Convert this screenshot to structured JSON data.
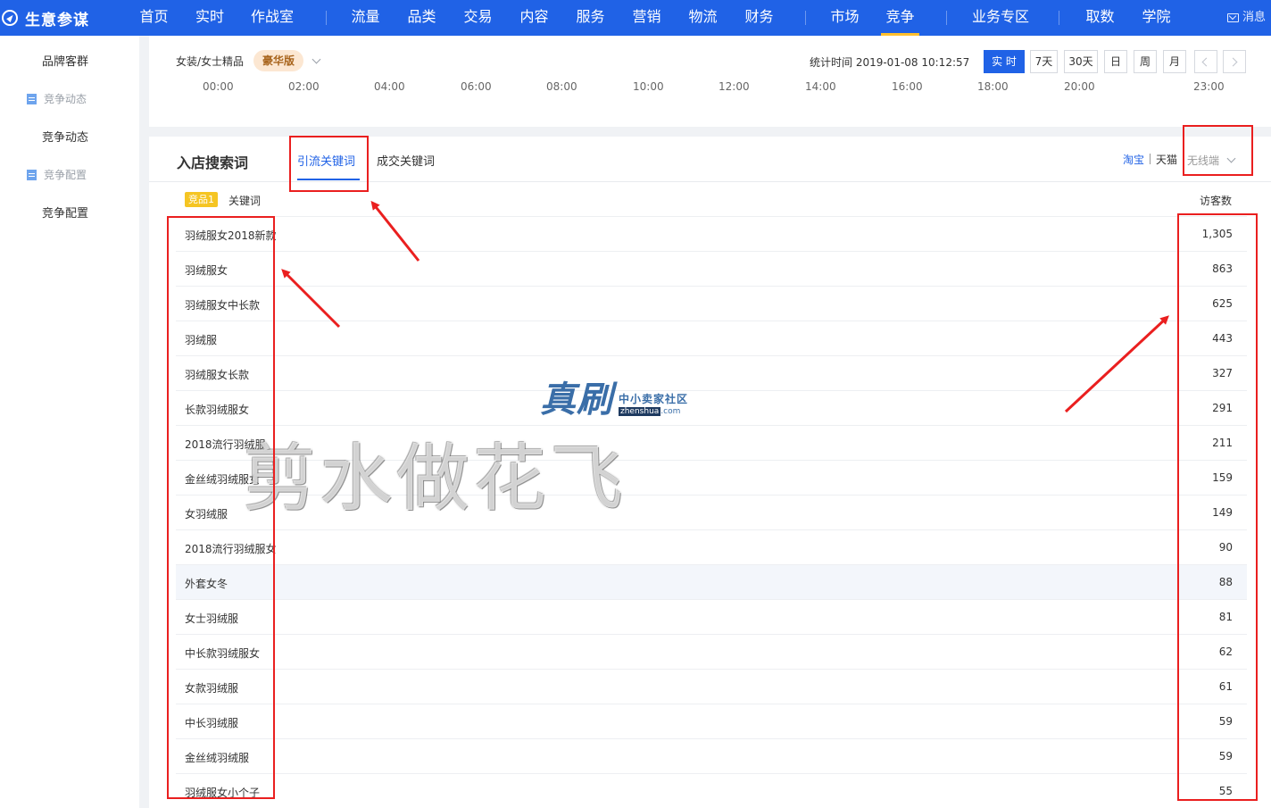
{
  "app": {
    "title": "生意参谋"
  },
  "nav": {
    "items": [
      {
        "label": "首页",
        "dot": false
      },
      {
        "label": "实时",
        "dot": false
      },
      {
        "label": "作战室",
        "dot": false
      },
      {
        "label": "流量",
        "dot": false
      },
      {
        "label": "品类",
        "dot": true
      },
      {
        "label": "交易",
        "dot": false
      },
      {
        "label": "内容",
        "dot": false
      },
      {
        "label": "服务",
        "dot": true
      },
      {
        "label": "营销",
        "dot": false
      },
      {
        "label": "物流",
        "dot": true
      },
      {
        "label": "财务",
        "dot": false
      },
      {
        "label": "市场",
        "dot": false
      },
      {
        "label": "竞争",
        "dot": false,
        "active": true
      },
      {
        "label": "业务专区",
        "dot": false
      },
      {
        "label": "取数",
        "dot": false
      },
      {
        "label": "学院",
        "dot": false
      }
    ],
    "message": "消息",
    "accent": "#2062e6",
    "active_color": "#ffc02e"
  },
  "sidebar": {
    "items": [
      {
        "label": "品牌客群",
        "type": "link"
      },
      {
        "label": "竞争动态",
        "type": "group",
        "icon": "doc-icon"
      },
      {
        "label": "竞争动态",
        "type": "link"
      },
      {
        "label": "竞争配置",
        "type": "group",
        "icon": "doc-icon"
      },
      {
        "label": "竞争配置",
        "type": "link"
      }
    ]
  },
  "header": {
    "category": "女装/女士精品",
    "edition": "豪华版",
    "stat_time": "统计时间 2019-01-08 10:12:57",
    "time_buttons": [
      "实 时",
      "7天",
      "30天",
      "日",
      "周",
      "月"
    ],
    "active_time": "实 时"
  },
  "chart": {
    "x_ticks": [
      "00:00",
      "02:00",
      "04:00",
      "06:00",
      "08:00",
      "10:00",
      "12:00",
      "14:00",
      "16:00",
      "18:00",
      "20:00",
      "23:00"
    ]
  },
  "keywords": {
    "title": "入店搜索词",
    "tabs": [
      {
        "label": "引流关键词",
        "active": true
      },
      {
        "label": "成交关键词",
        "active": false
      }
    ],
    "platforms": {
      "taobao": "淘宝",
      "tmall": "天猫"
    },
    "device": "无线端",
    "competitor_badge": "竞品1",
    "col_keyword": "关键词",
    "col_visitors": "访客数",
    "rows": [
      {
        "keyword": "羽绒服女2018新款",
        "visitors": "1,305"
      },
      {
        "keyword": "羽绒服女",
        "visitors": "863"
      },
      {
        "keyword": "羽绒服女中长款",
        "visitors": "625"
      },
      {
        "keyword": "羽绒服",
        "visitors": "443"
      },
      {
        "keyword": "羽绒服女长款",
        "visitors": "327"
      },
      {
        "keyword": "长款羽绒服女",
        "visitors": "291"
      },
      {
        "keyword": "2018流行羽绒服",
        "visitors": "211"
      },
      {
        "keyword": "金丝绒羽绒服女",
        "visitors": "159"
      },
      {
        "keyword": "女羽绒服",
        "visitors": "149"
      },
      {
        "keyword": "2018流行羽绒服女",
        "visitors": "90"
      },
      {
        "keyword": "外套女冬",
        "visitors": "88",
        "highlight": true
      },
      {
        "keyword": "女士羽绒服",
        "visitors": "81"
      },
      {
        "keyword": "中长款羽绒服女",
        "visitors": "62"
      },
      {
        "keyword": "女款羽绒服",
        "visitors": "61"
      },
      {
        "keyword": "中长羽绒服",
        "visitors": "59"
      },
      {
        "keyword": "金丝绒羽绒服",
        "visitors": "59"
      },
      {
        "keyword": "羽绒服女小个子",
        "visitors": "55"
      }
    ]
  },
  "watermark": {
    "logo_main": "真刷",
    "logo_sub": "中小卖家社区",
    "logo_domain": "zhenshua",
    "logo_tld": ".com",
    "overlay_text": "剪水做花飞"
  },
  "annotation_color": "#ea1f1f"
}
